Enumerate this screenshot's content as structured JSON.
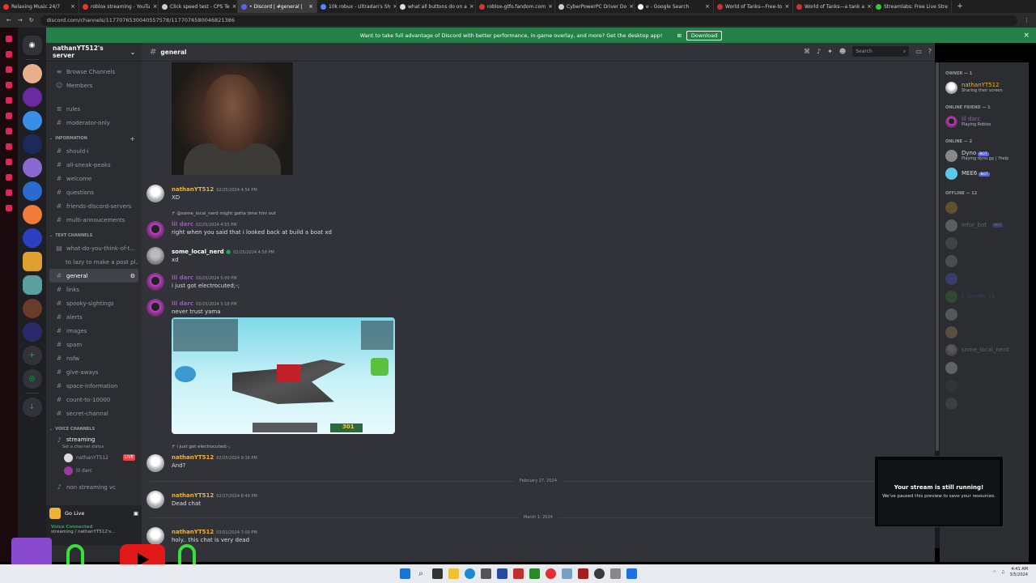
{
  "browser": {
    "tabs": [
      {
        "title": "Relaxing Music 24/7",
        "active": false
      },
      {
        "title": "roblox streaming - YouTu",
        "active": false
      },
      {
        "title": "Click speed test - CPS Te",
        "active": false
      },
      {
        "title": "• Discord | #general |",
        "active": true
      },
      {
        "title": "10k robux - Ultradan's Sh",
        "active": false
      },
      {
        "title": "what all buttons do on a",
        "active": false
      },
      {
        "title": "roblox-gtfo.fandom.com",
        "active": false
      },
      {
        "title": "CyberPowerPC Driver Do",
        "active": false
      },
      {
        "title": "e - Google Search",
        "active": false
      },
      {
        "title": "World of Tanks—Free-to",
        "active": false
      },
      {
        "title": "World of Tanks—a tank a",
        "active": false
      },
      {
        "title": "Streamlabs: Free Live Stre",
        "active": false
      }
    ],
    "url": "discord.com/channels/1177076530040557578/1177076580046821386"
  },
  "banner": {
    "text": "Want to take full advantage of Discord with better performance, in-game overlay, and more? Get the desktop app!",
    "button": "Download"
  },
  "server": {
    "name": "nathanYT512's server",
    "top_items": [
      "Browse Channels",
      "Members"
    ],
    "channels_top": [
      "rules",
      "moderator-only"
    ],
    "cat_information": "INFORMATION",
    "information": [
      "should-i",
      "all-sneak-peaks",
      "welcome",
      "questions",
      "friends-discord-servers",
      "multi-annoucements"
    ],
    "cat_text": "TEXT CHANNELS",
    "text_channels": [
      "what-do-you-think-of-t...",
      "to lazy to make a post pl...",
      "general",
      "links",
      "spooky-sightings",
      "alerts",
      "images",
      "spam",
      "nsfw",
      "give-aways",
      "space-information",
      "count-to-10000",
      "secret-channal"
    ],
    "cat_voice": "VOICE CHANNELS",
    "voice_channel": "streaming",
    "voice_status": "Set a channel status",
    "voice_users": [
      "nathanYT512",
      "lil darc"
    ],
    "live_badge": "LIVE",
    "voice_channel2": "non streaming vc",
    "go_live": "Go Live",
    "voice_connected": "Voice Connected",
    "voice_sub": "streaming / nathanYT512's..."
  },
  "chat": {
    "channel": "general",
    "search_placeholder": "Search",
    "messages": [
      {
        "user": "nathanYT512",
        "time": "02/25/2024 4:54 PM",
        "text": "XD"
      },
      {
        "reply": "@some_local_nerd might gotta time him out",
        "user": "lil darc",
        "time": "02/25/2024 4:55 PM",
        "text": "right when you said that i looked back at build a boat xd"
      },
      {
        "user": "some_local_nerd",
        "time": "02/25/2024 4:58 PM",
        "text": "xd"
      },
      {
        "user": "lil darc",
        "time": "02/25/2024 5:00 PM",
        "text": "i just got electrocuted;-;"
      },
      {
        "user": "lil darc",
        "time": "02/25/2024 5:18 PM",
        "text": "never trust yama"
      },
      {
        "reply": "i just got electrocuted;-;",
        "user": "nathanYT512",
        "time": "02/25/2024 9:16 PM",
        "text": "And?"
      },
      {
        "user": "nathanYT512",
        "time": "02/27/2024 8:49 PM",
        "text": "Dead chat"
      },
      {
        "user": "nathanYT512",
        "time": "03/01/2024 7:00 PM",
        "text": "holy.. this chat is very dead"
      }
    ],
    "dividers": [
      "February 27, 2024",
      "March 1, 2024"
    ],
    "game_score": "301"
  },
  "members": {
    "cat_owner": "OWNER — 1",
    "owner": {
      "name": "nathanYT512",
      "status": "Sharing their screen"
    },
    "cat_friend": "ONLINE FRIEND — 1",
    "friend": {
      "name": "lil darc",
      "status": "Playing Roblox"
    },
    "cat_online": "ONLINE — 2",
    "online": [
      {
        "name": "Dyno",
        "status": "Playing dyno.gg | ?help",
        "badge": "BOT"
      },
      {
        "name": "MEE6",
        "status": "",
        "badge": "BOT"
      }
    ],
    "cat_offline": "OFFLINE — 12",
    "offline": [
      "",
      "infor_bot",
      "",
      "",
      "",
      "t_lincoln_11",
      "",
      "",
      "some_local_nerd",
      "",
      "",
      ""
    ]
  },
  "stream_preview": {
    "title": "Your stream is still running!",
    "sub": "We've paused this preview to save your resources."
  },
  "tray": {
    "time": "4:41 AM",
    "date": "3/5/2024"
  },
  "colors": {
    "accent": "#5865f2",
    "green": "#248046",
    "owner": "#f0b232",
    "friend": "#9b59b6"
  }
}
